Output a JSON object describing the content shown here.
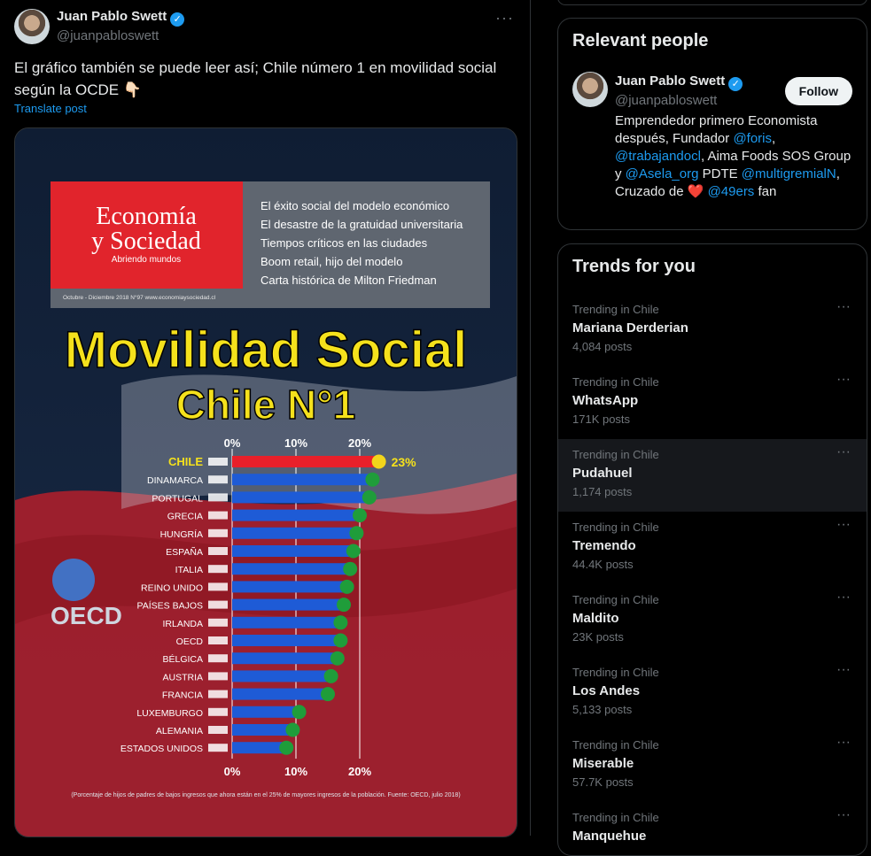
{
  "post": {
    "author_name": "Juan Pablo Swett",
    "author_handle": "@juanpabloswett",
    "text": "El gráfico también se puede leer así; Chile número 1 en movilidad social según la OCDE 👇🏻",
    "translate_label": "Translate post",
    "more_label": "···"
  },
  "magazine": {
    "brand_line1": "Economía",
    "brand_line2": "y Sociedad",
    "tagline": "Abriendo mundos",
    "issue": "Octubre - Diciembre 2018   N°97      www.economiaysociedad.cl",
    "headlines": [
      "El éxito social del modelo económico",
      "El desastre de la gratuidad universitaria",
      "Tiempos críticos en las ciudades",
      "Boom retail, hijo del modelo",
      "Carta histórica de Milton Friedman"
    ],
    "oecd": "OECD"
  },
  "chart_data": {
    "type": "bar",
    "title": "Movilidad Social",
    "subtitle": "Chile N°1",
    "highlight_label": "23%",
    "x_ticks": [
      "0%",
      "10%",
      "20%"
    ],
    "xlim": [
      0,
      23
    ],
    "footnote": "(Porcentaje de hijos de padres de bajos ingresos que ahora están en el 25% de mayores ingresos de la población. Fuente: OECD, julio 2018)",
    "categories": [
      "CHILE",
      "DINAMARCA",
      "PORTUGAL",
      "GRECIA",
      "HUNGRÍA",
      "ESPAÑA",
      "ITALIA",
      "REINO UNIDO",
      "PAÍSES BAJOS",
      "IRLANDA",
      "OECD",
      "BÉLGICA",
      "AUSTRIA",
      "FRANCIA",
      "LUXEMBURGO",
      "ALEMANIA",
      "ESTADOS UNIDOS"
    ],
    "values": [
      23,
      22,
      21.5,
      20,
      19.5,
      19,
      18.5,
      18,
      17.5,
      17,
      17,
      16.5,
      15.5,
      15,
      10.5,
      9.5,
      8.5
    ],
    "colors": {
      "highlight": "#e8202a",
      "bar": "#1e5bd6",
      "dot": "#1f9d3a",
      "highlight_dot": "#f2d51b"
    }
  },
  "relevant": {
    "heading": "Relevant people",
    "name": "Juan Pablo Swett",
    "handle": "@juanpabloswett",
    "follow_label": "Follow",
    "bio_1": "Emprendedor primero Economista después, Fundador ",
    "bio_link_1": "@foris",
    "bio_2": ", ",
    "bio_link_2": "@trabajandocl",
    "bio_3": ", Aima Foods SOS Group y ",
    "bio_link_3": "@Asela_org",
    "bio_4": " PDTE ",
    "bio_link_4": "@multigremialN",
    "bio_5": ", Cruzado de ❤️ ",
    "bio_link_5": "@49ers",
    "bio_6": " fan"
  },
  "trends": {
    "heading": "Trends for you",
    "items": [
      {
        "context": "Trending in Chile",
        "name": "Mariana Derderian",
        "posts": "4,084 posts"
      },
      {
        "context": "Trending in Chile",
        "name": "WhatsApp",
        "posts": "171K posts"
      },
      {
        "context": "Trending in Chile",
        "name": "Pudahuel",
        "posts": "1,174 posts"
      },
      {
        "context": "Trending in Chile",
        "name": "Tremendo",
        "posts": "44.4K posts"
      },
      {
        "context": "Trending in Chile",
        "name": "Maldito",
        "posts": "23K posts"
      },
      {
        "context": "Trending in Chile",
        "name": "Los Andes",
        "posts": "5,133 posts"
      },
      {
        "context": "Trending in Chile",
        "name": "Miserable",
        "posts": "57.7K posts"
      },
      {
        "context": "Trending in Chile",
        "name": "Manquehue",
        "posts": ""
      }
    ],
    "more_label": "···"
  }
}
